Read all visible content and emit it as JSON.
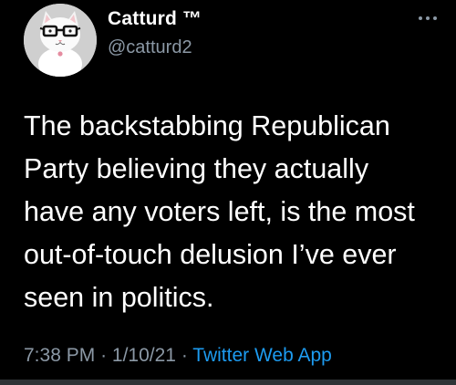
{
  "user": {
    "display_name": "Catturd ™",
    "handle": "@catturd2"
  },
  "tweet": {
    "text": "The backstabbing Republican\nParty believing they actually\nhave any voters left, is the most\nout-of-touch delusion I’ve ever\nseen in politics."
  },
  "meta": {
    "time": "7:38 PM",
    "separator": "·",
    "date": "1/10/21",
    "app": "Twitter Web App"
  },
  "icons": {
    "avatar": "cat-with-glasses-avatar",
    "more": "more-options-icon"
  },
  "colors": {
    "background": "#000000",
    "text": "#ffffff",
    "secondary": "#8b98a5",
    "link": "#1d9bf0"
  }
}
